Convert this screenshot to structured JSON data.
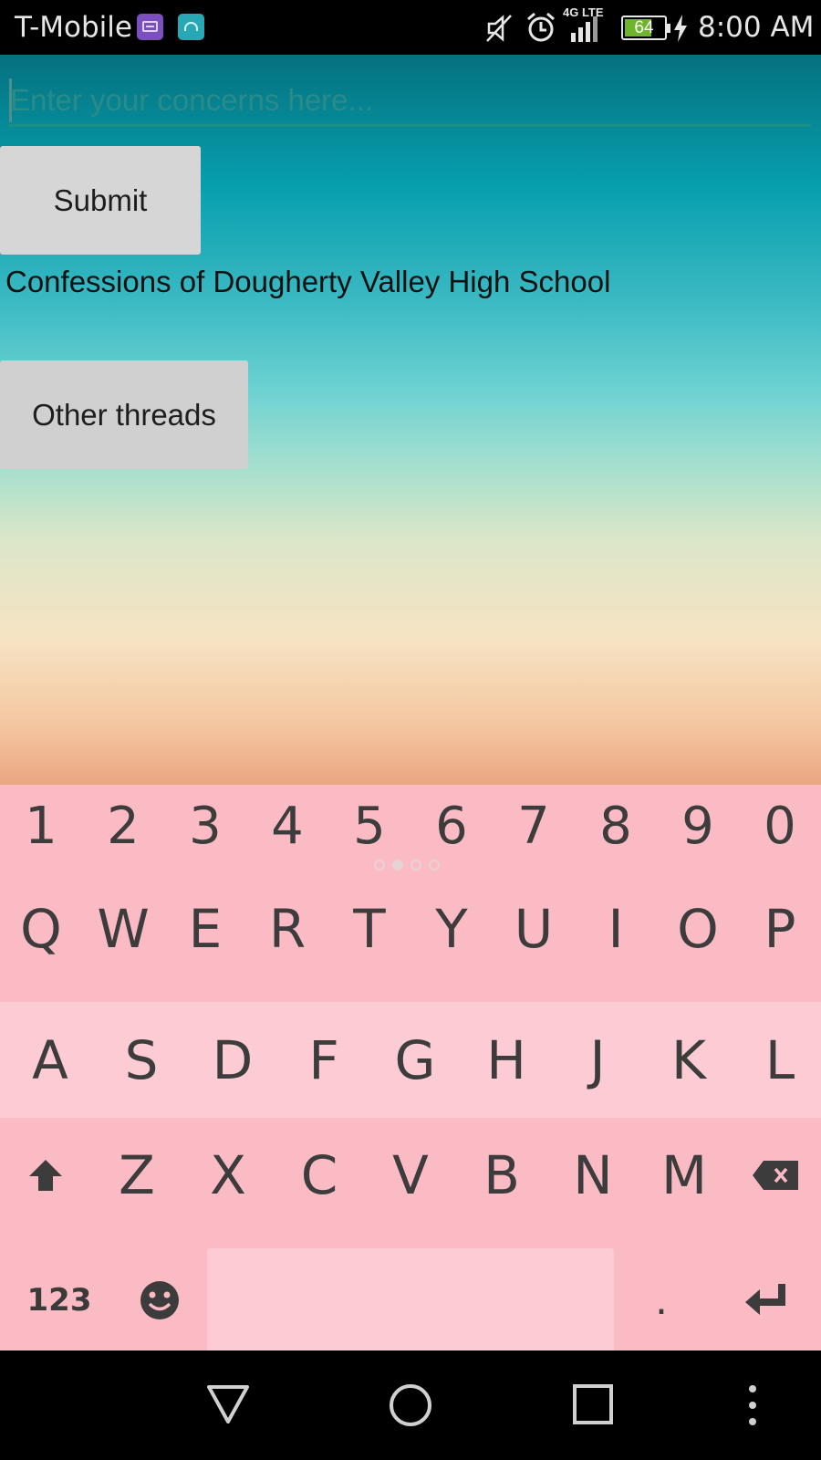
{
  "status_bar": {
    "carrier": "T-Mobile",
    "network_type": "4G LTE",
    "battery_level": "64",
    "battery_percent": 64,
    "time": "8:00 AM",
    "icons": [
      "keyboard-notification-icon",
      "android-notification-icon",
      "mute-icon",
      "alarm-icon",
      "signal-icon",
      "battery-icon",
      "charging-icon"
    ]
  },
  "app": {
    "concerns_input": {
      "value": "",
      "placeholder": "Enter your concerns here..."
    },
    "submit_label": "Submit",
    "heading": "Confessions of Dougherty Valley High School",
    "other_threads_label": "Other threads",
    "colors": {
      "gradient_top": "#05717f",
      "gradient_middle": "#6dd2d2",
      "gradient_bottom": "#eaa682",
      "input_underline": "#1a8f84",
      "button_bg": "#d6d6d6"
    }
  },
  "keyboard": {
    "number_row": [
      "1",
      "2",
      "3",
      "4",
      "5",
      "6",
      "7",
      "8",
      "9",
      "0"
    ],
    "row_q": [
      "Q",
      "W",
      "E",
      "R",
      "T",
      "Y",
      "U",
      "I",
      "O",
      "P"
    ],
    "row_a": [
      "A",
      "S",
      "D",
      "F",
      "G",
      "H",
      "J",
      "K",
      "L"
    ],
    "row_z": [
      "Z",
      "X",
      "C",
      "V",
      "B",
      "N",
      "M"
    ],
    "symbols_key": "123",
    "period_key": ".",
    "page_count": 4,
    "active_page": 2,
    "colors": {
      "background": "#fbbbc4",
      "highlight_row": "#fdcbd3",
      "key_text": "#3c3c3c"
    }
  },
  "nav_bar": {
    "buttons": [
      "back-icon",
      "home-icon",
      "recents-icon",
      "menu-icon"
    ]
  }
}
